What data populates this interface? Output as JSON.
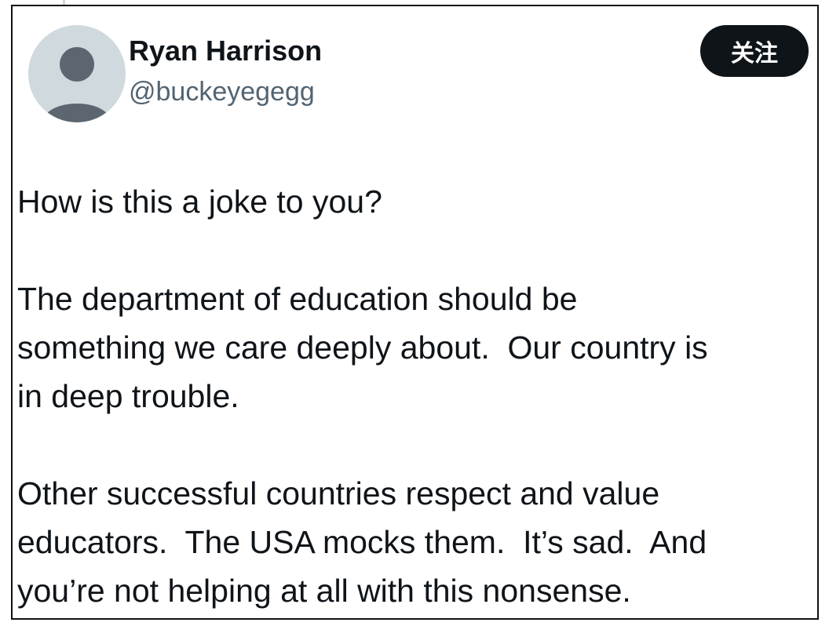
{
  "author": {
    "name": "Ryan Harrison",
    "handle": "@buckeyegegg"
  },
  "follow_button": {
    "label": "关注"
  },
  "tweet": {
    "paragraphs": [
      [
        "How is this a joke to you?"
      ],
      [
        "The department of education should be",
        "something we care deeply about.  Our country is",
        "in deep trouble."
      ],
      [
        "Other successful countries respect and value",
        "educators.  The USA mocks them.  It’s sad.  And",
        "you’re not helping at all with this nonsense."
      ]
    ]
  },
  "colors": {
    "name_text": "#0f1419",
    "handle_text": "#536471",
    "button_bg": "#0f1419",
    "avatar_bg": "#cfd9de",
    "avatar_figure": "#5b6670"
  },
  "icons": {
    "avatar": "default-profile-silhouette"
  }
}
